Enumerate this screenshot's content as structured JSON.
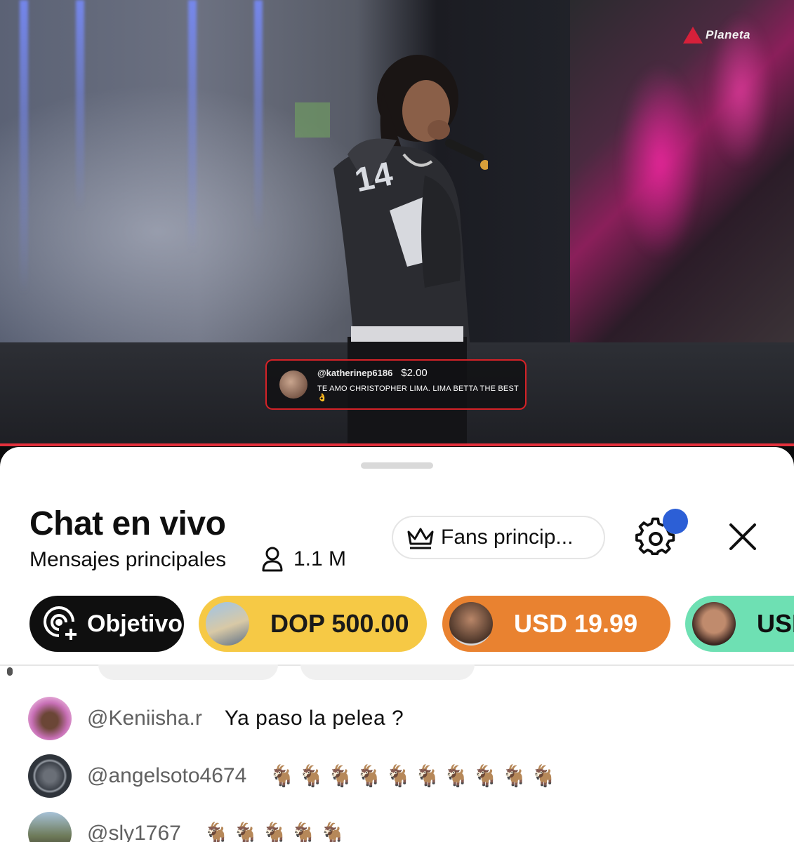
{
  "video": {
    "logo_text": "Planeta",
    "superchat": {
      "user": "@katherinep6186",
      "amount": "$2.00",
      "message": "TE AMO CHRISTOPHER LIMA. LIMA BETTA THE BEST 👌"
    },
    "jersey_number": "14",
    "accent_color": "#e3303c"
  },
  "chat": {
    "title": "Chat en vivo",
    "subtitle": "Mensajes principales",
    "viewers": "1.1 M",
    "fans_button": "Fans princip...",
    "icons": {
      "viewers": "person-icon",
      "fans": "crown-icon",
      "settings": "gear-icon",
      "close": "close-icon",
      "objetivo": "goal-add-icon"
    },
    "notification_dot_color": "#2c5fd6",
    "chips": [
      {
        "label": "Objetivo",
        "color": "#0f0f0f"
      },
      {
        "label": "DOP 500.00",
        "color": "#f6c945"
      },
      {
        "label": "USD 19.99",
        "color": "#e98230"
      },
      {
        "label": "USD",
        "color": "#6ee0b3"
      }
    ],
    "messages": [
      {
        "author": "@Keniisha.r",
        "text": "Ya paso la pelea ?"
      },
      {
        "author": "@angelsoto4674",
        "text": "🐐🐐🐐🐐🐐🐐🐐🐐🐐🐐"
      },
      {
        "author": "@sly1767",
        "text": "🐐🐐🐐🐐🐐"
      }
    ]
  }
}
